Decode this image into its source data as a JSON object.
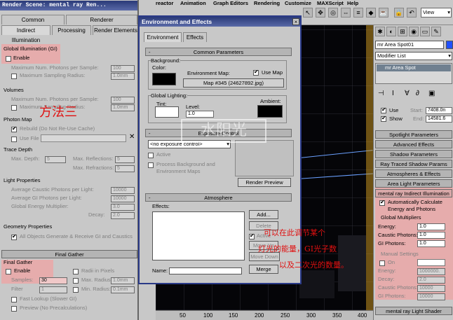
{
  "menubar": {
    "items": [
      "reactor",
      "Animation",
      "Graph Editors",
      "Rendering",
      "Customize",
      "MAXScript",
      "Help"
    ],
    "view_select": "View"
  },
  "render_panel": {
    "title": "Render Scene: mental ray Ren...",
    "tabs_row1": [
      "Common",
      "Renderer"
    ],
    "tabs_row2": [
      "Indirect Illumination",
      "Processing",
      "Render Elements"
    ],
    "gi": {
      "header": "Global Illumination (GI)",
      "enable": "Enable",
      "max_photons": "Maximum Num. Photons per Sample:",
      "max_photons_val": "100",
      "max_radius": "Maximum Sampling Radius:",
      "max_radius_val": "1.0mm"
    },
    "volumes": {
      "header": "Volumes",
      "max_photons": "Maximum Num. Photons per Sample:",
      "max_photons_val": "100",
      "max_radius": "Maximum Sampling Radius:",
      "max_radius_val": "1.0mm"
    },
    "photon_map": {
      "header": "Photon Map",
      "rebuild": "Rebuild (Do Not Re-Use Cache)",
      "use_file": "Use File"
    },
    "trace": {
      "header": "Trace Depth",
      "max_depth": "Max. Depth:",
      "max_depth_val": "5",
      "max_reflections": "Max. Reflections:",
      "max_reflections_val": "5",
      "max_refractions": "Max. Refractions:",
      "max_refractions_val": "5"
    },
    "light": {
      "header": "Light Properties",
      "avg_caustic": "Average Caustic Photons per Light:",
      "avg_caustic_val": "10000",
      "avg_gi": "Average GI Photons per Light:",
      "avg_gi_val": "10000",
      "energy": "Global Energy Multiplier:",
      "energy_val": "3.0",
      "decay": "Decay:",
      "decay_val": "2.0"
    },
    "geometry": {
      "header": "Geometry Properties",
      "all_objects": "All Objects Generate & Receive GI and Caustics"
    },
    "final_gather_rollout": "Final Gather",
    "fg": {
      "header": "Final Gather",
      "enable": "Enable",
      "radii": "Radii in Pixels",
      "samples": "Samples:",
      "samples_val": "30",
      "max_radius": "Max. Radius:",
      "max_radius_val": "1.0mm",
      "filter": "Filter",
      "filter_val": "1",
      "min_radius": "Min. Radius:",
      "min_radius_val": "0.1mm",
      "fast_lookup": "Fast Lookup (Slower GI)",
      "preview": "Preview (No Precalculations)"
    }
  },
  "env": {
    "title": "Environment and Effects",
    "tabs": [
      "Environment",
      "Effects"
    ],
    "common_rollout": "Common Parameters",
    "background": "Background:",
    "color": "Color:",
    "env_map": "Environment Map:",
    "use_map": "Use Map",
    "map_button": "Map #345 (24627892.jpg)",
    "global_lighting": "Global Lighting:",
    "tint": "Tint:",
    "level": "Level:",
    "level_val": "1.0",
    "ambient": "Ambient:",
    "exposure_rollout": "Exposure Control",
    "exposure_select": "<no exposure control>",
    "active": "Active",
    "process_bg": "Process Background and Environment Maps",
    "render_preview": "Render Preview",
    "atmosphere_rollout": "Atmosphere",
    "effects": "Effects:",
    "add": "Add...",
    "delete": "Delete",
    "active2": "Active",
    "move_up": "Move Up",
    "move_down": "Move Down",
    "name": "Name:",
    "merge": "Merge"
  },
  "right_panel": {
    "object_name": "mr Area Spot01",
    "modifier_list": "Modifier List",
    "stack_item": "mr Area Spot",
    "use": "Use",
    "show": "Show",
    "start": "Start:",
    "start_val": "7408.0n",
    "end": "End:",
    "end_val": "14581.6",
    "rollouts": [
      "Spotlight Parameters",
      "Advanced Effects",
      "Shadow Parameters",
      "Ray Traced Shadow Params",
      "Atmospheres & Effects",
      "Area Light Parameters",
      "mental ray Indirect Illumination"
    ],
    "auto_calc": "Automatically Calculate Energy and Photons",
    "global_multipliers": "Global Multipliers",
    "energy": "Energy:",
    "energy_val": "1.0",
    "caustic": "Caustic Photons:",
    "caustic_val": "1.0",
    "gi_photons": "GI Photons:",
    "gi_photons_val": "1.0",
    "manual": "Manual Settings",
    "on": "On",
    "m_energy": "Energy:",
    "m_energy_val": "1000000.",
    "m_decay": "Decay:",
    "m_decay_val": "2.0",
    "m_caustic": "Caustic Photons:",
    "m_caustic_val": "10000",
    "m_gi": "GI Photons:",
    "m_gi_val": "10000",
    "shader": "mental ray Light Shader"
  },
  "ruler": [
    "50",
    "100",
    "150",
    "200",
    "250",
    "300",
    "350",
    "400"
  ],
  "annotations": {
    "method": "方法三",
    "watermark": "水阳光",
    "note1": "可以在此调节某个",
    "note2": "灯光的能量，GI光子数",
    "note3": "以及二次光的数量。"
  }
}
